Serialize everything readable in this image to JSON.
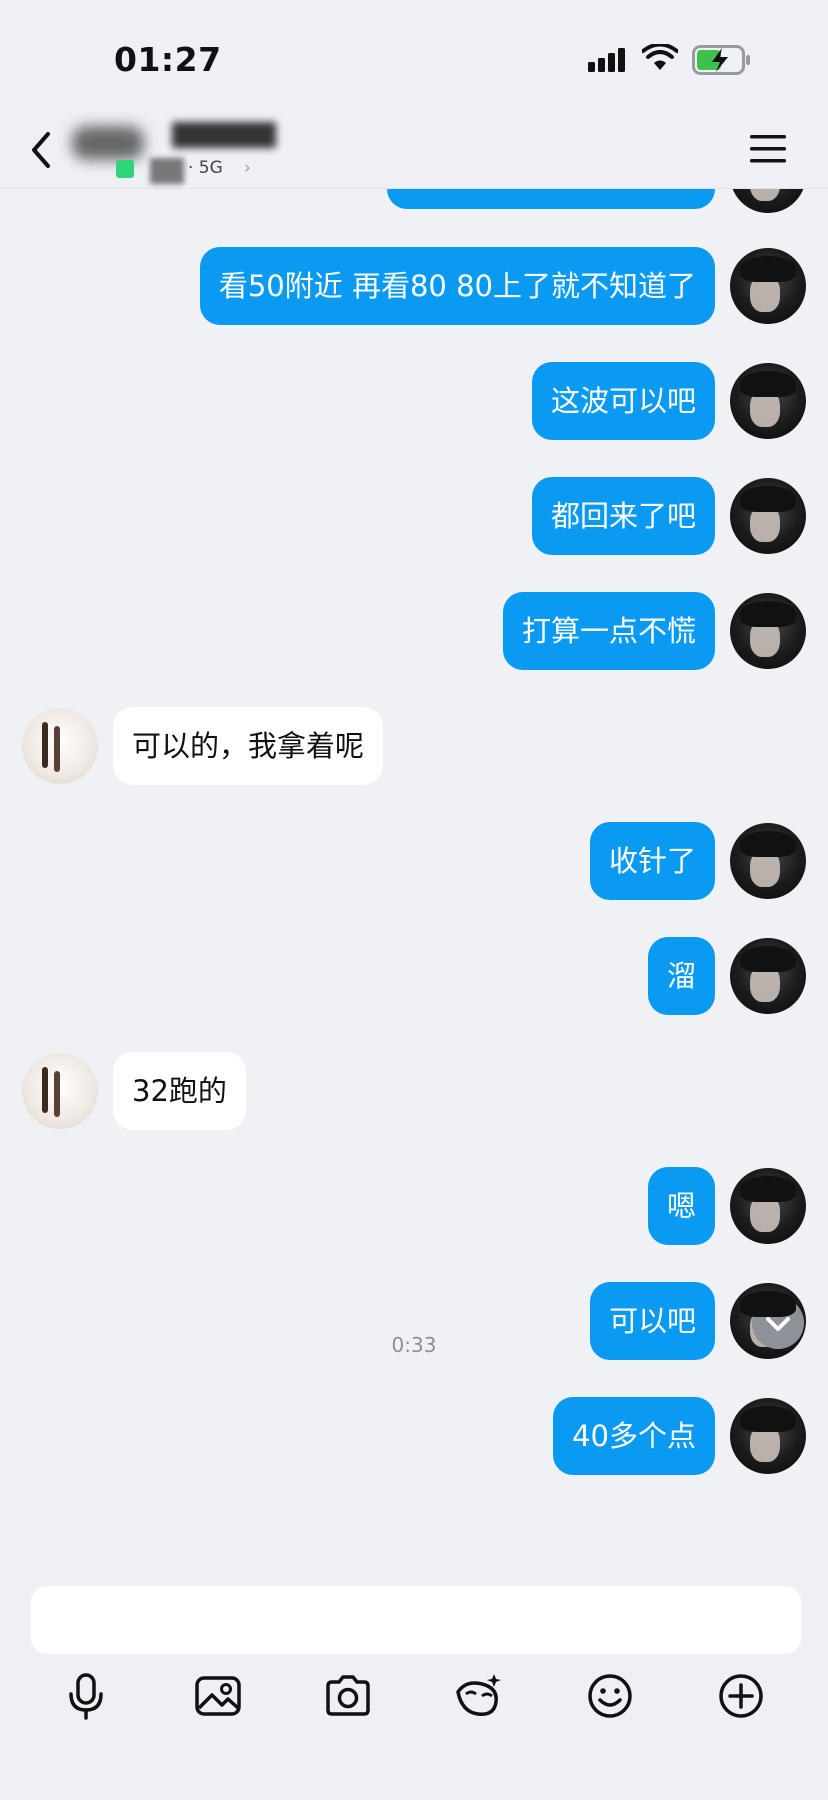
{
  "status": {
    "time": "01:27"
  },
  "header": {
    "network": "· 5G"
  },
  "messages": [
    {
      "dir": "out",
      "text": "看50附近 再看80 80上了就不知道了"
    },
    {
      "dir": "out",
      "text": "这波可以吧"
    },
    {
      "dir": "out",
      "text": "都回来了吧"
    },
    {
      "dir": "out",
      "text": "打算一点不慌"
    },
    {
      "dir": "in",
      "text": "可以的，我拿着呢"
    },
    {
      "dir": "out",
      "text": "收针了"
    },
    {
      "dir": "out",
      "text": "溜"
    },
    {
      "dir": "in",
      "text": "32跑的"
    },
    {
      "dir": "out",
      "text": "嗯"
    },
    {
      "dir": "out",
      "text": "可以吧"
    },
    {
      "dir": "out",
      "text": "40多个点"
    }
  ],
  "time_label": "0:33",
  "composer": {
    "placeholder": ""
  },
  "toolbar": [
    "microphone-icon",
    "image-icon",
    "camera-icon",
    "sticker-icon",
    "emoji-icon",
    "plus-icon"
  ],
  "colors": {
    "outgoing_bubble": "#0a9af2",
    "incoming_bubble": "#ffffff",
    "background": "#f0f1f5",
    "online": "#2fd57a"
  }
}
